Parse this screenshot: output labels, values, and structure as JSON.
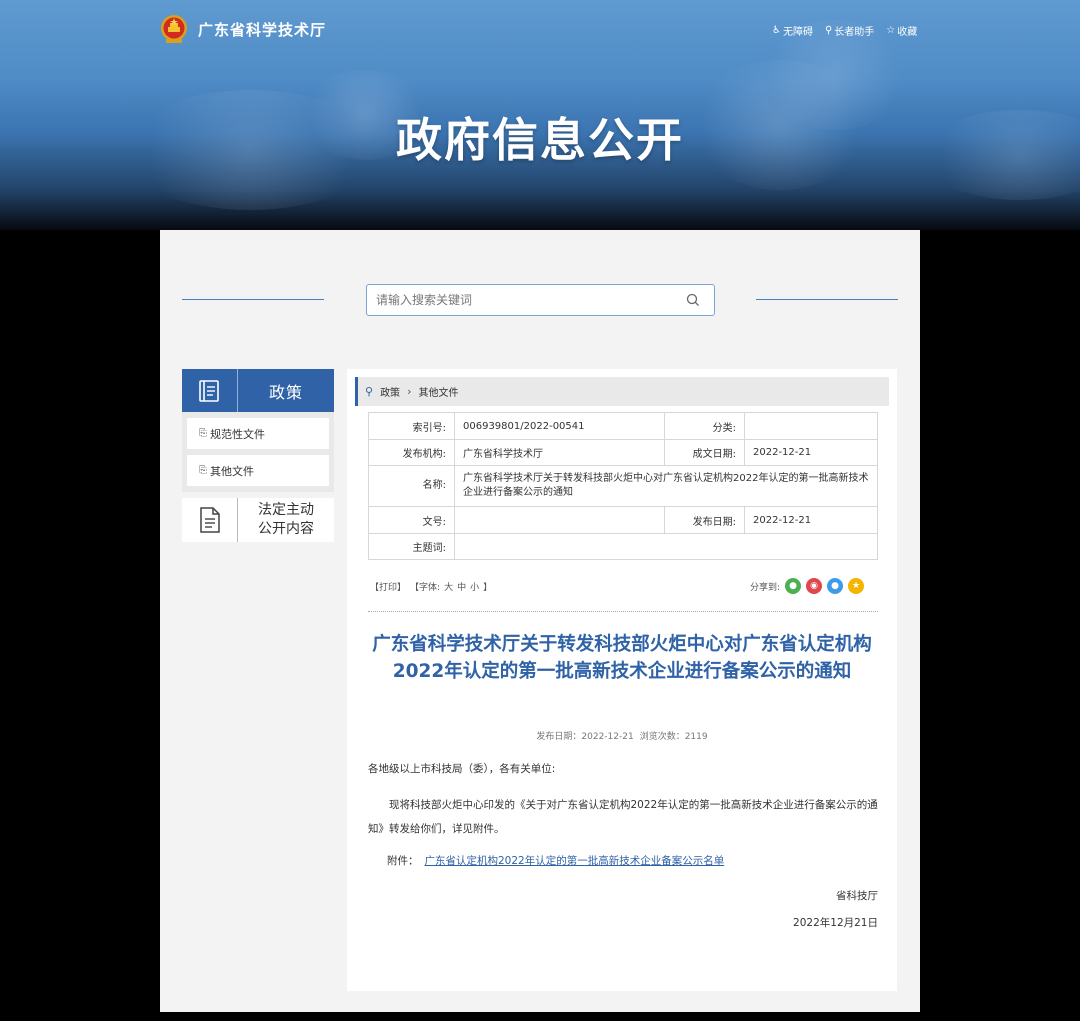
{
  "header": {
    "site_name": "广东省科学技术厅",
    "banner_title": "政府信息公开",
    "links": [
      {
        "icon": "accessibility-icon",
        "label": "无障碍"
      },
      {
        "icon": "elder-assist-icon",
        "label": "长者助手"
      },
      {
        "icon": "star-icon",
        "label": "收藏"
      }
    ]
  },
  "search": {
    "placeholder": "请输入搜索关键词"
  },
  "sidebar": {
    "title": "政策",
    "items": [
      {
        "label": "规范性文件"
      },
      {
        "label": "其他文件"
      }
    ],
    "law_label_line1": "法定主动",
    "law_label_line2": "公开内容"
  },
  "breadcrumb": {
    "items": [
      "政策",
      "其他文件"
    ]
  },
  "meta": {
    "index_key": "索引号:",
    "index_value": "006939801/2022-00541",
    "category_key": "分类:",
    "category_value": "",
    "publisher_key": "发布机构:",
    "publisher_value": "广东省科学技术厅",
    "written_date_key": "成文日期:",
    "written_date_value": "2022-12-21",
    "name_key": "名称:",
    "name_value": "广东省科学技术厅关于转发科技部火炬中心对广东省认定机构2022年认定的第一批高新技术企业进行备案公示的通知",
    "doc_no_key": "文号:",
    "doc_no_value": "",
    "publish_date_key": "发布日期:",
    "publish_date_value": "2022-12-21",
    "subject_key": "主题词:",
    "subject_value": ""
  },
  "tools": {
    "print": "【打印】",
    "font_prefix": "【字体:",
    "font_large": "大",
    "font_medium": "中",
    "font_small": "小",
    "font_suffix": "】",
    "share_label": "分享到:"
  },
  "share_icons": [
    {
      "name": "wechat-icon",
      "color": "#4caf50"
    },
    {
      "name": "weibo-icon",
      "color": "#e0474c"
    },
    {
      "name": "qq-icon",
      "color": "#3d9be9"
    },
    {
      "name": "qzone-icon",
      "color": "#f5b400"
    }
  ],
  "article": {
    "title": "广东省科学技术厅关于转发科技部火炬中心对广东省认定机构2022年认定的第一批高新技术企业进行备案公示的通知",
    "publish_date": "发布日期：2022-12-21",
    "views": "浏览次数：2119",
    "greeting": "各地级以上市科技局（委），各有关单位:",
    "paragraph": "现将科技部火炬中心印发的《关于对广东省认定机构2022年认定的第一批高新技术企业进行备案公示的通知》转发给你们，详见附件。",
    "attachment_label": "附件：",
    "attachment_link": "广东省认定机构2022年认定的第一批高新技术企业备案公示名单",
    "signature": "省科技厅",
    "date": "2022年12月21日"
  },
  "colors": {
    "accent": "#2f62a6",
    "banner": "#4f8bc6"
  }
}
